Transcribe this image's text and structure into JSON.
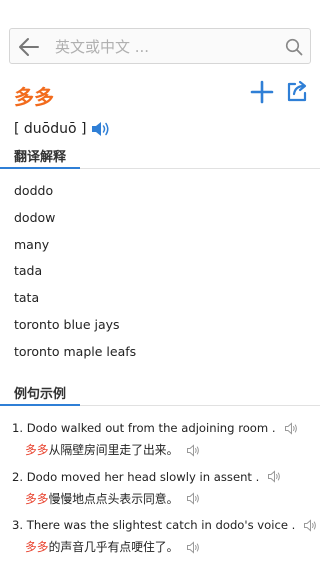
{
  "search": {
    "placeholder": "英文或中文 ...",
    "value": ""
  },
  "entry": {
    "word": "多多",
    "phonetic": "[ duōduō ]"
  },
  "translations": {
    "title": "翻译解释",
    "items": [
      "doddo",
      "dodow",
      "many",
      "tada",
      "tata",
      "toronto blue jays",
      "toronto maple leafs"
    ]
  },
  "examples": {
    "title": "例句示例",
    "items": [
      {
        "en": "1. Dodo walked out from the adjoining room .",
        "cn_highlight": "多多",
        "cn_rest": "从隔壁房间里走了出来。"
      },
      {
        "en": "2. Dodo moved her head slowly in assent .",
        "cn_highlight": "多多",
        "cn_rest": "慢慢地点点头表示同意。"
      },
      {
        "en": "3. There was the slightest catch in dodo's voice .",
        "cn_highlight": "多多",
        "cn_rest": "的声音几乎有点哽住了。"
      }
    ]
  },
  "colors": {
    "accent": "#2f7fd6",
    "headword": "#f26b1d",
    "highlight": "#e8432f"
  },
  "icons": [
    "back-arrow-icon",
    "search-icon",
    "add-icon",
    "share-icon",
    "speaker-icon"
  ]
}
